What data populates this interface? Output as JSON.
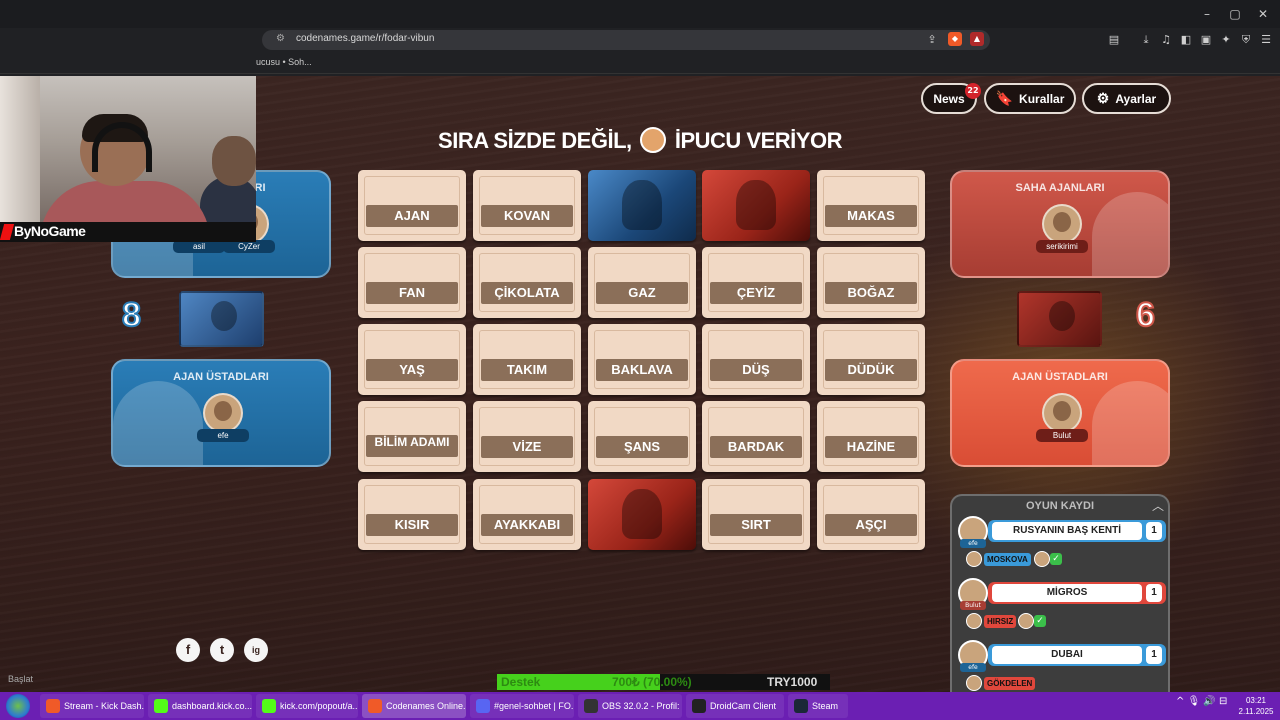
{
  "browser": {
    "url": "codenames.game/r/fodar-vibun",
    "bookmark": "ucusu • Soh...",
    "window_controls": [
      "–",
      "▢",
      "✕"
    ]
  },
  "stream": {
    "brand": "ByNoGame"
  },
  "header": {
    "news_label": "News",
    "news_count": "22",
    "rules_label": "Kurallar",
    "settings_label": "Ayarlar"
  },
  "status": {
    "prefix": "SIRA SİZDE DEĞİL,",
    "suffix": "İPUCU VERİYOR"
  },
  "blue_team": {
    "operatives_title": "SAHA AJANLARI",
    "operatives": [
      "asil",
      "CyZer"
    ],
    "score": "8",
    "spymasters_title": "AJAN ÜSTADLARI",
    "spymasters": [
      "efe"
    ],
    "color": "#2a7db7"
  },
  "red_team": {
    "operatives_title": "SAHA AJANLARI",
    "operatives": [
      "serikirimi"
    ],
    "score": "6",
    "spymasters_title": "AJAN ÜSTADLARI",
    "spymasters": [
      "Bulut"
    ],
    "color": "#d0584a"
  },
  "board": {
    "cards": [
      {
        "word": "AJAN",
        "state": "hidden"
      },
      {
        "word": "KOVAN",
        "state": "hidden"
      },
      {
        "word": "",
        "state": "blue"
      },
      {
        "word": "",
        "state": "red"
      },
      {
        "word": "MAKAS",
        "state": "hidden"
      },
      {
        "word": "FAN",
        "state": "hidden"
      },
      {
        "word": "ÇİKOLATA",
        "state": "hidden"
      },
      {
        "word": "GAZ",
        "state": "hidden"
      },
      {
        "word": "ÇEYİZ",
        "state": "hidden"
      },
      {
        "word": "BOĞAZ",
        "state": "hidden"
      },
      {
        "word": "YAŞ",
        "state": "hidden"
      },
      {
        "word": "TAKIM",
        "state": "hidden"
      },
      {
        "word": "BAKLAVA",
        "state": "hidden"
      },
      {
        "word": "DÜŞ",
        "state": "hidden"
      },
      {
        "word": "DÜDÜK",
        "state": "hidden"
      },
      {
        "word": "BİLİM ADAMI",
        "state": "hidden"
      },
      {
        "word": "VİZE",
        "state": "hidden"
      },
      {
        "word": "ŞANS",
        "state": "hidden"
      },
      {
        "word": "BARDAK",
        "state": "hidden"
      },
      {
        "word": "HAZİNE",
        "state": "hidden"
      },
      {
        "word": "KISIR",
        "state": "hidden"
      },
      {
        "word": "AYAKKABI",
        "state": "hidden"
      },
      {
        "word": "",
        "state": "red"
      },
      {
        "word": "SIRT",
        "state": "hidden"
      },
      {
        "word": "AŞÇI",
        "state": "hidden"
      }
    ]
  },
  "game_log": {
    "title": "OYUN KAYDI",
    "entries": [
      {
        "giver": "efe",
        "team": "blue",
        "clue": "RUSYANIN BAŞ KENTİ",
        "number": "1",
        "guesses": [
          {
            "player": "CyZer",
            "word": "MOSKOVA",
            "color": "#3a9ad9",
            "check": true
          }
        ]
      },
      {
        "giver": "Bulut",
        "team": "red",
        "clue": "MİGROS",
        "number": "1",
        "guesses": [
          {
            "player": "serikirimi",
            "word": "HIRSIZ",
            "color": "#e0473c",
            "check": true
          }
        ]
      },
      {
        "giver": "efe",
        "team": "blue",
        "clue": "DUBAI",
        "number": "1",
        "guesses": [
          {
            "player": "CyZer",
            "word": "GÖKDELEN",
            "color": "#e0473c",
            "check": false
          }
        ]
      }
    ]
  },
  "social": [
    "f",
    "t",
    "ig"
  ],
  "donation": {
    "label": "Destek",
    "amount": "700₺ (70.00%)",
    "goal": "TRY1000",
    "progress": 0.7
  },
  "start_label": "Başlat",
  "taskbar": {
    "items": [
      {
        "label": "Stream - Kick Dash...",
        "color": "#f05a28"
      },
      {
        "label": "dashboard.kick.co...",
        "color": "#53fc18"
      },
      {
        "label": "kick.com/popout/a...",
        "color": "#53fc18"
      },
      {
        "label": "Codenames Online...",
        "color": "#f05a28",
        "active": true
      },
      {
        "label": "#genel-sohbet | FO...",
        "color": "#5865f2"
      },
      {
        "label": "OBS 32.0.2 - Profil: l...",
        "color": "#333333"
      },
      {
        "label": "DroidCam Client",
        "color": "#222222"
      },
      {
        "label": "Steam",
        "color": "#1b2838"
      }
    ],
    "tray": "^  🎙  🔊  ⊟",
    "time": "03:21",
    "date": "2.11.2025"
  }
}
